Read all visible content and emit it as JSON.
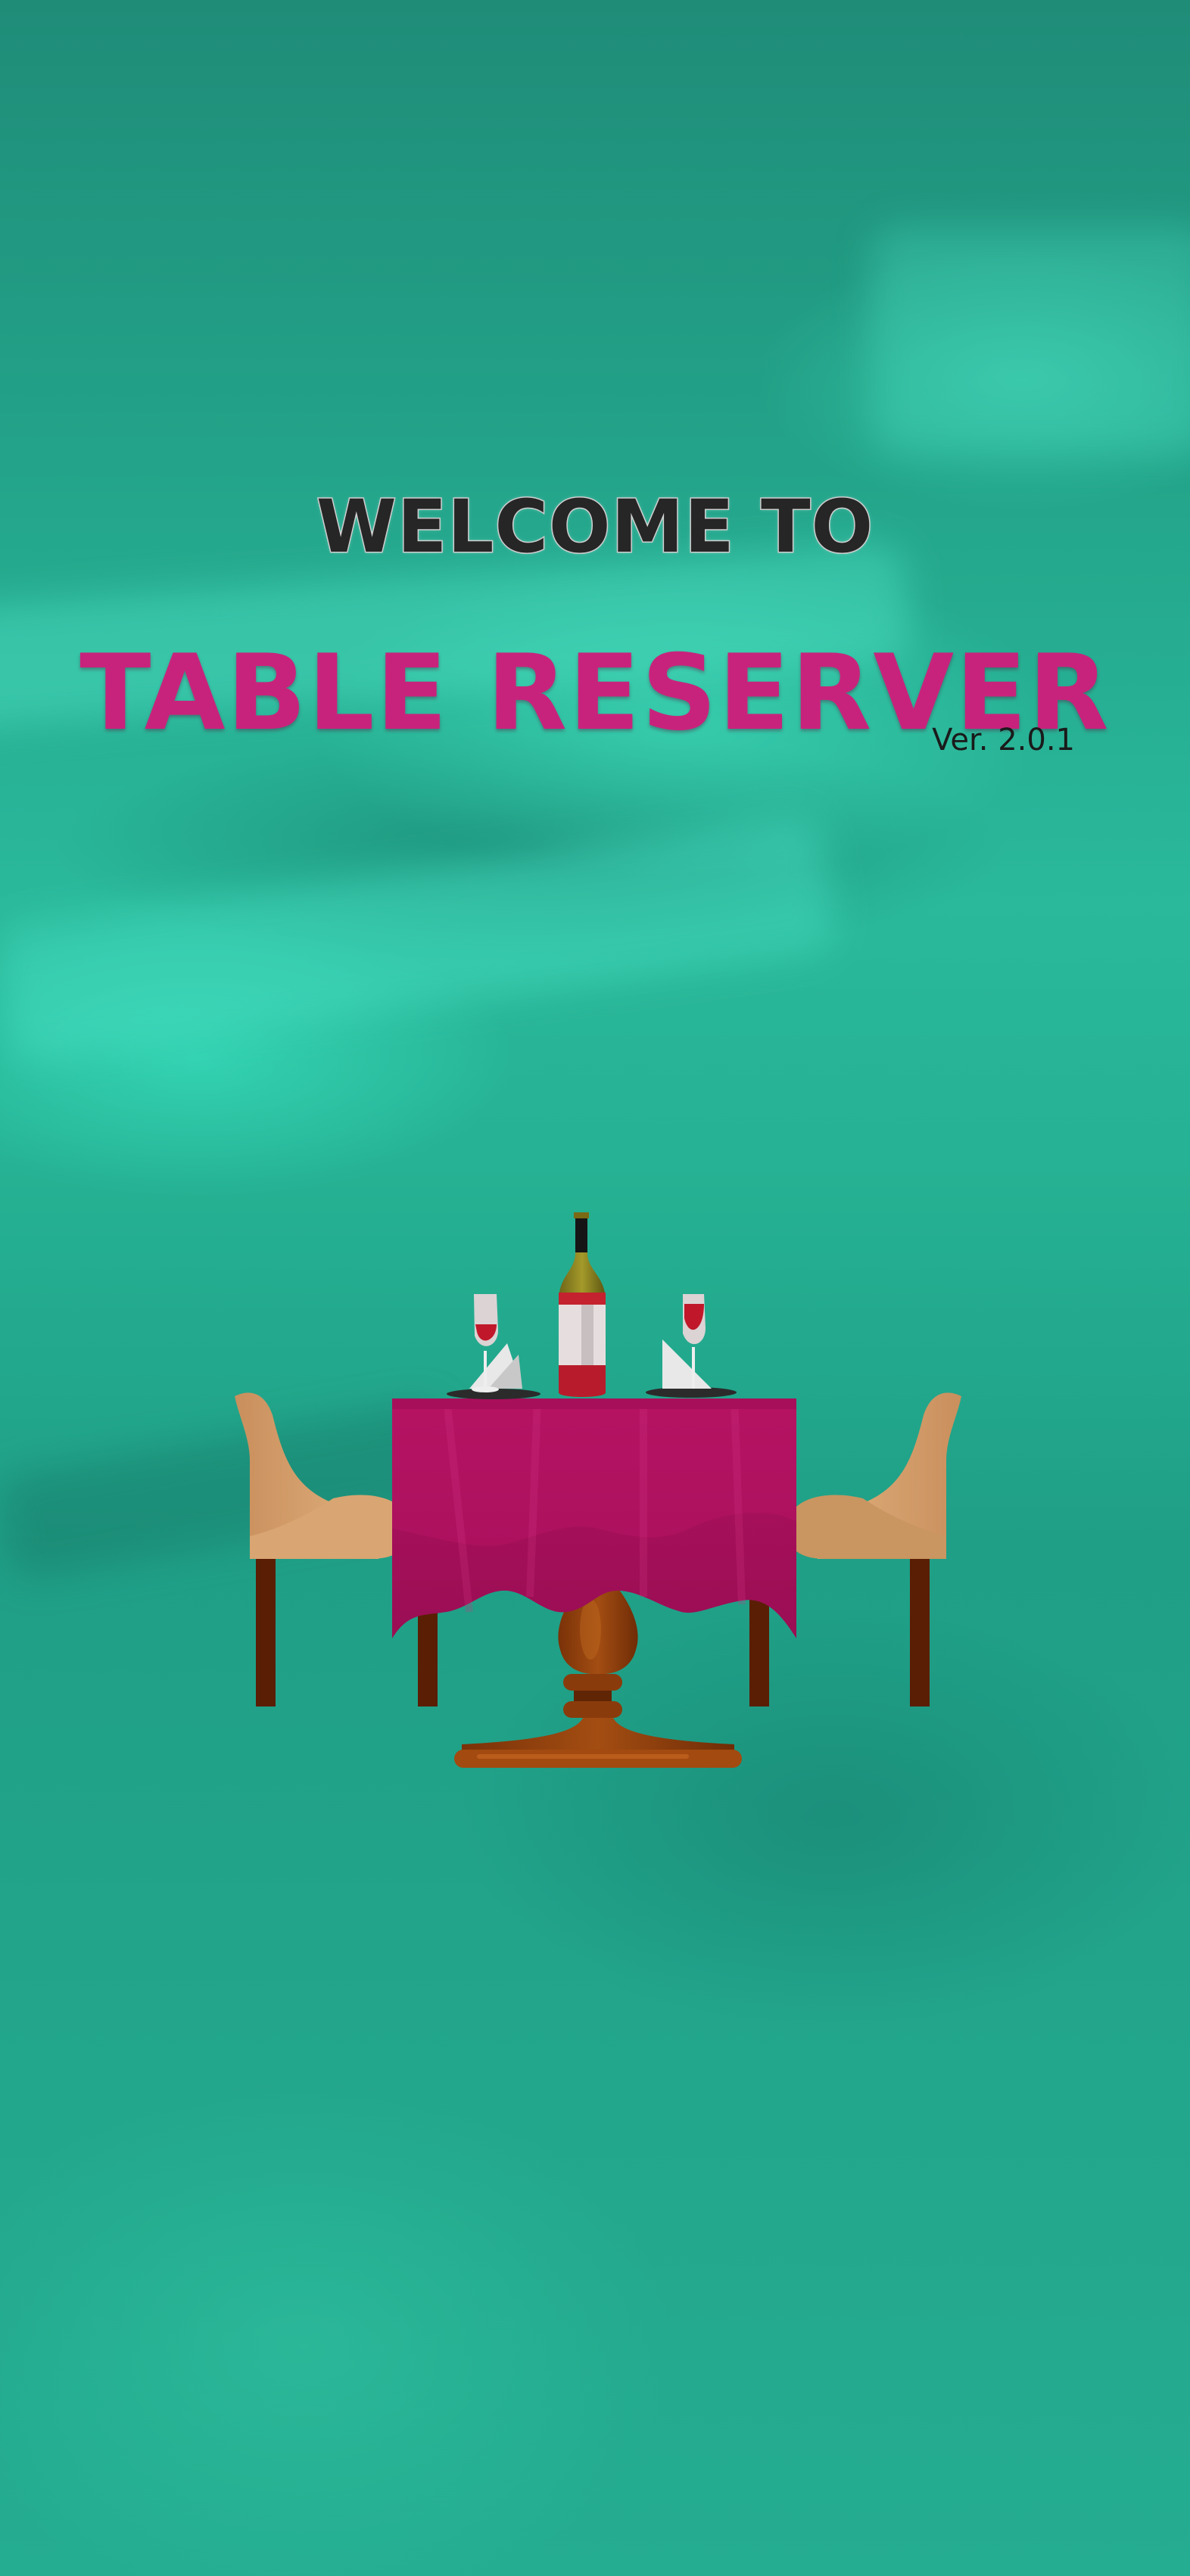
{
  "welcome_text": "WELCOME TO",
  "app_name": "TABLE RESERVER",
  "version": "Ver. 2.0.1",
  "illustration": "dining-table-illustration",
  "colors": {
    "background": "#23a48a",
    "title_accent": "#c8237c",
    "welcome_text": "#262626"
  }
}
